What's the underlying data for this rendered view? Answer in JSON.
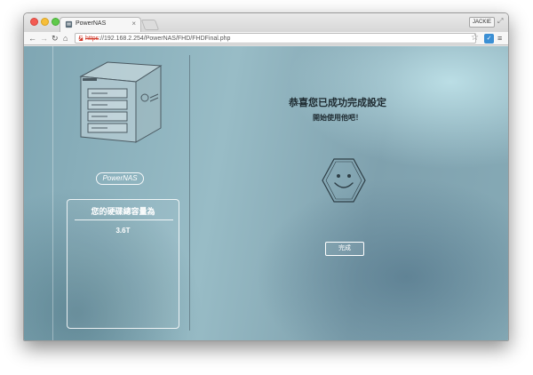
{
  "browser": {
    "tab_title": "PowerNAS",
    "tab_close": "×",
    "user_name": "JACKIE",
    "url_scheme": "https",
    "url_rest": "://192.168.2.254/PowerNAS/FHD/FHDFinal.php"
  },
  "sidebar": {
    "brand_text": "PowerNAS",
    "capacity_label": "您的硬碟總容量為",
    "capacity_value": "3.6T"
  },
  "main": {
    "title": "恭喜您已成功完成設定",
    "subtitle": "開始使用他吧！",
    "done_label": "完成"
  },
  "icons": {
    "traffic_lights": [
      "close-dot",
      "minimize-dot",
      "zoom-dot"
    ],
    "nav": [
      "back-arrow-icon",
      "forward-arrow-icon",
      "reload-icon",
      "home-icon"
    ],
    "smiley": "smiley-hexagon-icon"
  },
  "colors": {
    "accent_white": "#ffffff",
    "heading_text": "#1e2a30",
    "page_bg": "#8fb3be",
    "url_scheme_red": "#d13b2c"
  }
}
